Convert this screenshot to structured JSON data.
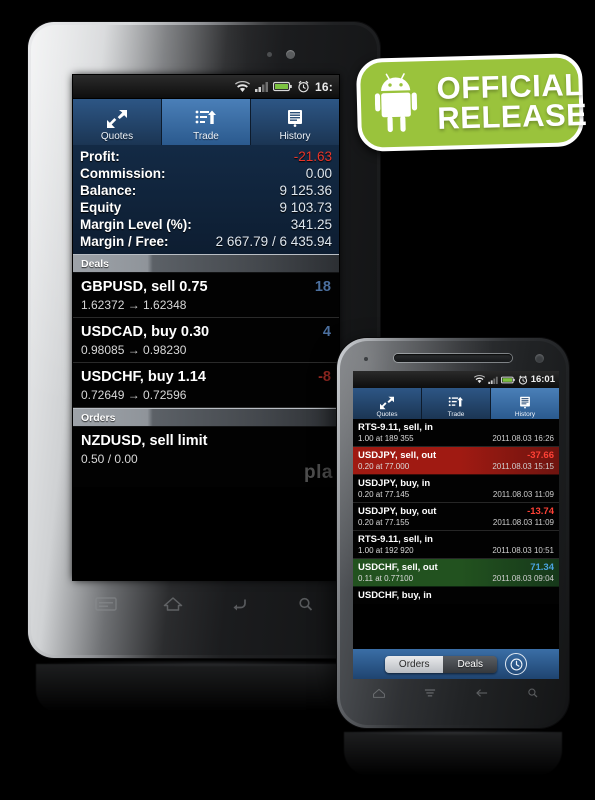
{
  "badge": {
    "line1": "OFFICIAL",
    "line2": "RELEASE",
    "robot_icon": "android-robot-icon",
    "color": "#9ac33c"
  },
  "tablet": {
    "status": {
      "time": "16:",
      "icons": [
        "wifi-icon",
        "signal-icon",
        "battery-icon",
        "alarm-icon"
      ]
    },
    "tabs": [
      {
        "label": "Quotes",
        "icon": "quotes-arrows-icon",
        "selected": false
      },
      {
        "label": "Trade",
        "icon": "trade-list-up-icon",
        "selected": true
      },
      {
        "label": "History",
        "icon": "history-monitor-icon",
        "selected": false
      }
    ],
    "summary": [
      {
        "key": "Profit:",
        "value": "-21.63",
        "negative": true
      },
      {
        "key": "Commission:",
        "value": "0.00",
        "negative": false
      },
      {
        "key": "Balance:",
        "value": "9 125.36",
        "negative": false
      },
      {
        "key": "Equity",
        "value": "9 103.73",
        "negative": false
      },
      {
        "key": "Margin Level (%):",
        "value": "341.25",
        "negative": false
      },
      {
        "key": "Margin / Free:",
        "value": "2 667.79 / 6 435.94",
        "negative": false
      }
    ],
    "sections": {
      "deals_label": "Deals",
      "orders_label": "Orders"
    },
    "deals": [
      {
        "symbol": "GBPUSD, sell 0.75",
        "prices": "1.62372 → 1.62348",
        "profit": "18",
        "sign": "pos"
      },
      {
        "symbol": "USDCAD, buy 0.30",
        "prices": "0.98085 → 0.98230",
        "profit": "4",
        "sign": "pos"
      },
      {
        "symbol": "USDCHF, buy 1.14",
        "prices": "0.72649 → 0.72596",
        "profit": "-8",
        "sign": "neg"
      }
    ],
    "orders": [
      {
        "symbol": "NZDUSD, sell limit",
        "prices": "0.50 / 0.00",
        "profit": "",
        "sign": "pos"
      }
    ],
    "watermark": "pla",
    "nav": [
      "menu-icon",
      "home-icon",
      "back-icon",
      "search-icon"
    ]
  },
  "phone": {
    "status": {
      "time": "16:01",
      "icons": [
        "wifi-icon",
        "signal-icon",
        "battery-icon",
        "alarm-icon"
      ]
    },
    "tabs": [
      {
        "label": "Quotes",
        "icon": "quotes-arrows-icon",
        "selected": false
      },
      {
        "label": "Trade",
        "icon": "trade-list-up-icon",
        "selected": false
      },
      {
        "label": "History",
        "icon": "history-monitor-icon",
        "selected": true
      }
    ],
    "history": [
      {
        "symbol": "RTS-9.11, sell, in",
        "volume": "1.00 at 189 355",
        "date": "2011.08.03 16:26",
        "profit": "",
        "state": "normal"
      },
      {
        "symbol": "USDJPY, sell, out",
        "volume": "0.20 at 77.000",
        "date": "2011.08.03 15:15",
        "profit": "-37.66",
        "state": "red"
      },
      {
        "symbol": "USDJPY, buy, in",
        "volume": "0.20 at 77.145",
        "date": "2011.08.03 11:09",
        "profit": "",
        "state": "normal"
      },
      {
        "symbol": "USDJPY, buy, out",
        "volume": "0.20 at 77.155",
        "date": "2011.08.03 11:09",
        "profit": "-13.74",
        "state": "normal"
      },
      {
        "symbol": "RTS-9.11, sell, in",
        "volume": "1.00 at 192 920",
        "date": "2011.08.03 10:51",
        "profit": "",
        "state": "normal"
      },
      {
        "symbol": "USDCHF, sell, out",
        "volume": "0.11 at 0.77100",
        "date": "2011.08.03 09:04",
        "profit": "71.34",
        "state": "green"
      },
      {
        "symbol": "USDCHF, buy, in",
        "volume": "",
        "date": "",
        "profit": "",
        "state": "normal"
      }
    ],
    "segmented": {
      "left": "Orders",
      "right": "Deals",
      "selected": "Orders",
      "clock_icon": "clock-icon"
    },
    "nav": [
      "home-icon",
      "menu-icon",
      "back-icon",
      "search-icon"
    ]
  }
}
